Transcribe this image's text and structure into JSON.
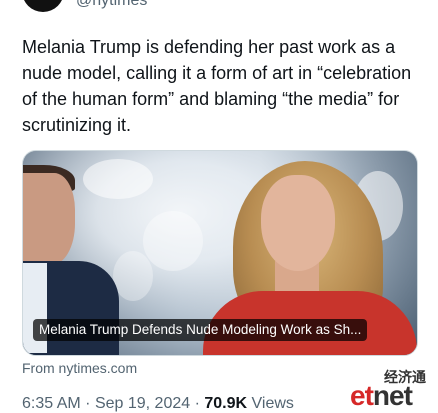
{
  "account": {
    "handle": "@nytimes"
  },
  "tweet": {
    "text": "Melania Trump is defending her past work as a nude model, calling it a form of art in “celebration of the human form” and blaming “the media” for scrutinizing it."
  },
  "link_card": {
    "headline": "Melania Trump Defends Nude Modeling Work as Sh...",
    "source": "From nytimes.com"
  },
  "meta": {
    "time": "6:35 AM",
    "separator": "·",
    "date": "Sep 19, 2024",
    "views_count": "70.9K",
    "views_label": "Views"
  },
  "watermark": {
    "chinese": "经济通",
    "brand": "etnet",
    "brand_first": "et",
    "brand_rest": "net"
  },
  "colors": {
    "text_primary": "#0f1419",
    "text_secondary": "#536471",
    "card_border": "#cfd9de",
    "watermark_red": "#d62828"
  }
}
